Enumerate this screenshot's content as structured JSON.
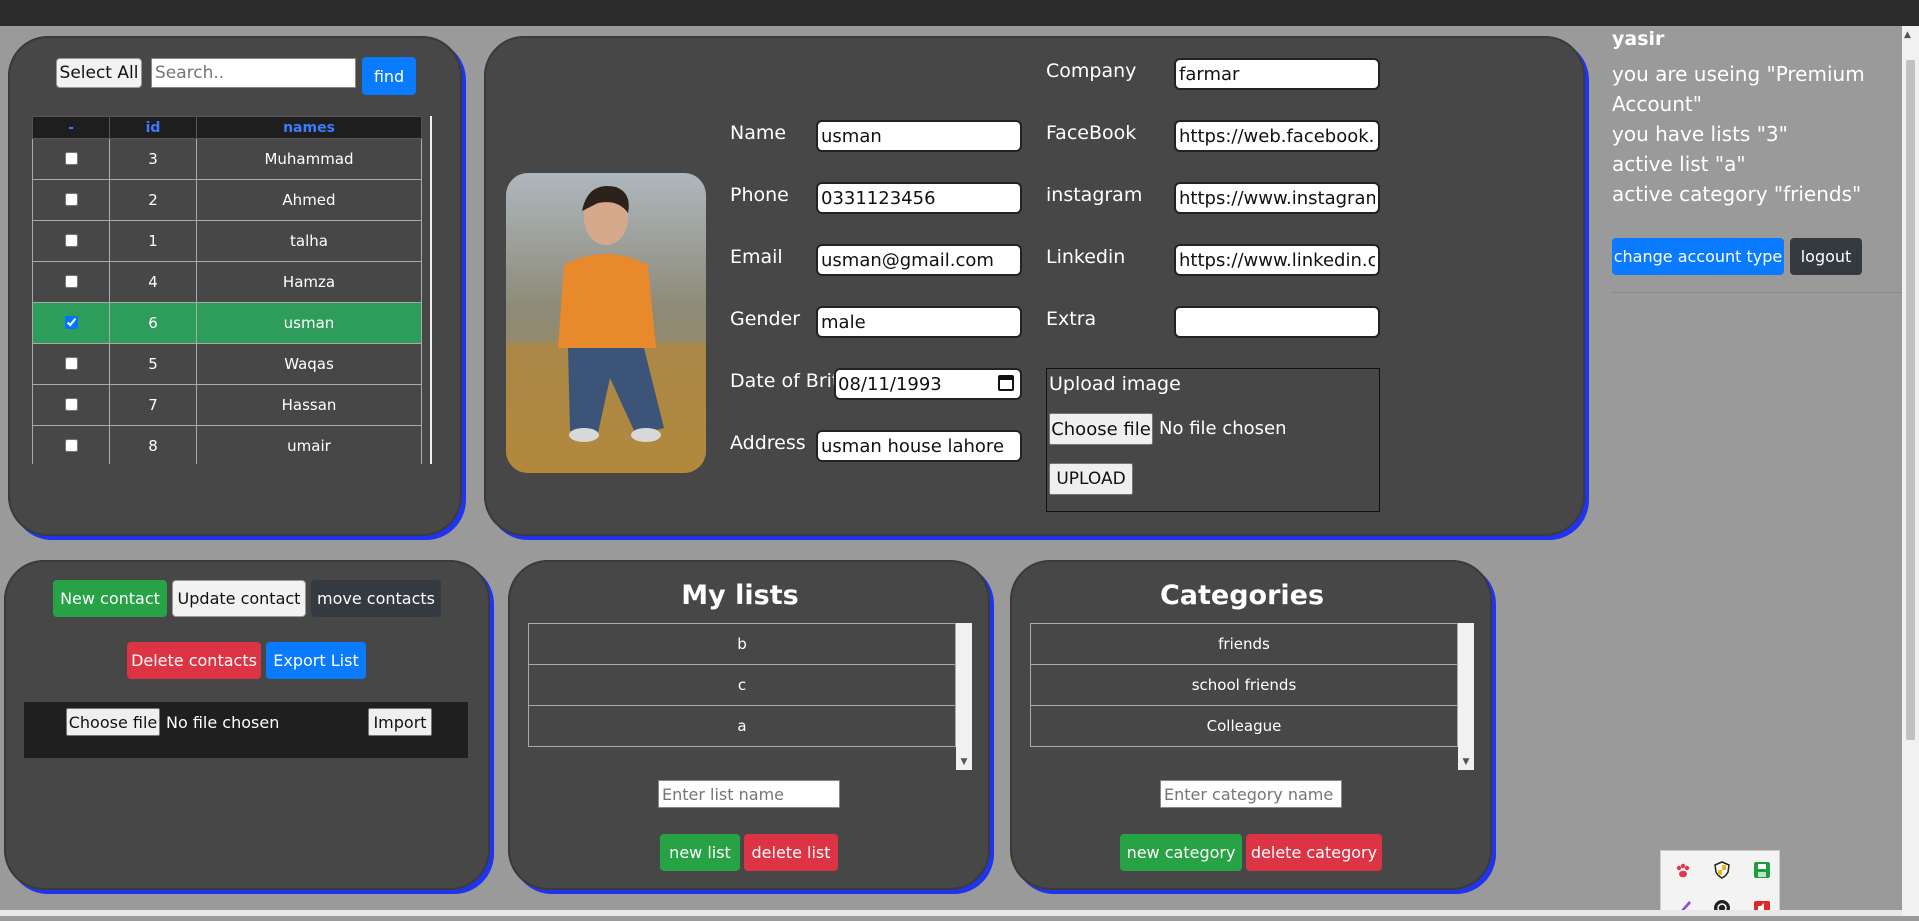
{
  "user": {
    "name": "yasir",
    "lines": [
      "you are useing \"Premium",
      "Account\"",
      "you have lists \"3\"",
      "active list \"a\"",
      "active category \"friends\""
    ],
    "change_account_label": "change account type",
    "logout_label": "logout"
  },
  "contacts": {
    "select_all_label": "Select All",
    "search_placeholder": "Search..",
    "find_label": "find",
    "columns": [
      "-",
      "id",
      "names"
    ],
    "rows": [
      {
        "id": "3",
        "name": "Muhammad",
        "checked": false
      },
      {
        "id": "2",
        "name": "Ahmed",
        "checked": false
      },
      {
        "id": "1",
        "name": "talha",
        "checked": false
      },
      {
        "id": "4",
        "name": "Hamza",
        "checked": false
      },
      {
        "id": "6",
        "name": "usman",
        "checked": true
      },
      {
        "id": "5",
        "name": "Waqas",
        "checked": false
      },
      {
        "id": "7",
        "name": "Hassan",
        "checked": false
      },
      {
        "id": "8",
        "name": "umair",
        "checked": false
      }
    ]
  },
  "details": {
    "labels": {
      "name": "Name",
      "phone": "Phone",
      "email": "Email",
      "gender": "Gender",
      "dob": "Date of Brith",
      "address": "Address",
      "company": "Company",
      "facebook": "FaceBook",
      "instagram": "instagram",
      "linkedin": "Linkedin",
      "extra": "Extra"
    },
    "values": {
      "name": "usman",
      "phone": "0331123456",
      "email": "usman@gmail.com",
      "gender": "male",
      "dob": "08/11/1993",
      "address": "usman house lahore",
      "company": "farmar",
      "facebook": "https://web.facebook.com",
      "instagram": "https://www.instagram.com",
      "linkedin": "https://www.linkedin.com",
      "extra": ""
    },
    "upload": {
      "title": "Upload image",
      "choose_label": "Choose file",
      "no_file": "No file chosen",
      "upload_label": "UPLOAD"
    }
  },
  "actions": {
    "new_contact": "New contact",
    "update_contact": "Update contact",
    "move_contacts": "move contacts",
    "delete_contacts": "Delete contacts",
    "export_list": "Export List",
    "choose_label": "Choose file",
    "no_file": "No file chosen",
    "import_label": "Import"
  },
  "lists": {
    "title": "My lists",
    "items": [
      "b",
      "c",
      "a"
    ],
    "input_placeholder": "Enter list name",
    "new_label": "new list",
    "delete_label": "delete list"
  },
  "categories": {
    "title": "Categories",
    "items": [
      "friends",
      "school friends",
      "Colleague"
    ],
    "input_placeholder": "Enter category name",
    "new_label": "new category",
    "delete_label": "delete category"
  },
  "colors": {
    "panel": "#474747",
    "panel_border": "#1f34f0",
    "selected_row": "#2e9c5a",
    "blue": "#0a7bff",
    "green": "#27a244",
    "red": "#dc3444"
  },
  "tray_icons": [
    "paw-icon",
    "shield-icon",
    "save-icon",
    "pen-icon",
    "openai-icon",
    "speaker-icon"
  ]
}
